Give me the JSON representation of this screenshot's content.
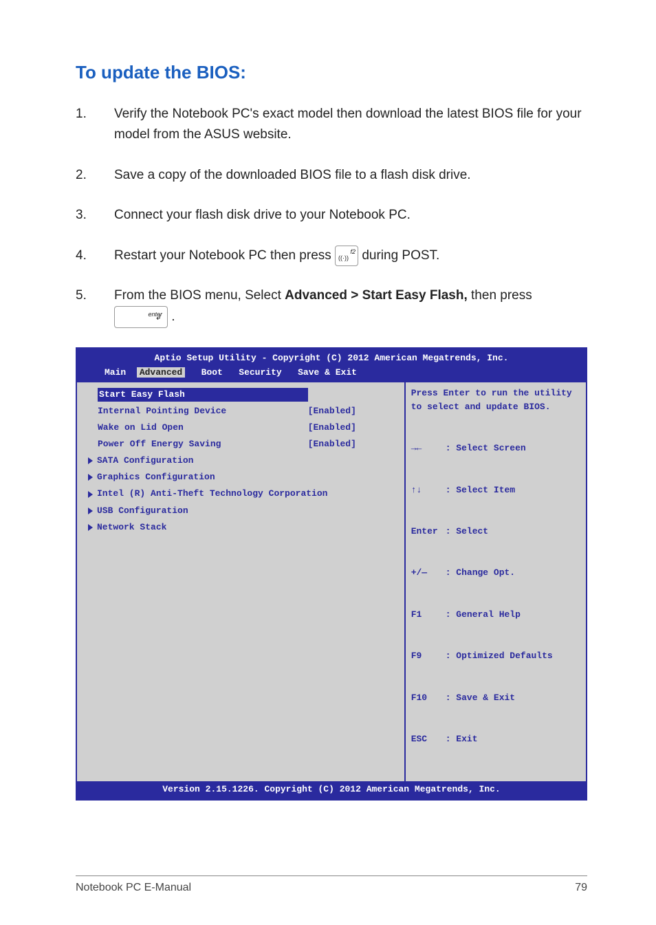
{
  "heading": "To update the BIOS:",
  "steps": {
    "s1": {
      "num": "1.",
      "text": "Verify the Notebook PC's exact model then download the latest BIOS file for your model from the ASUS website."
    },
    "s2": {
      "num": "2.",
      "text": "Save a copy of the downloaded BIOS file to a flash disk drive."
    },
    "s3": {
      "num": "3.",
      "text": "Connect your flash disk drive to your Notebook PC."
    },
    "s4": {
      "num": "4.",
      "pre": "Restart your Notebook PC then press ",
      "post": " during POST."
    },
    "s5": {
      "num": "5.",
      "pre": "From the BIOS menu, Select ",
      "bold": "Advanced > Start Easy Flash,",
      "mid": " then press ",
      "post": "."
    }
  },
  "keys": {
    "f2": {
      "label": "f2",
      "icon": "((·))"
    },
    "enter": {
      "label": "enter",
      "arrow": "↲"
    }
  },
  "bios": {
    "title": "Aptio Setup Utility - Copyright (C) 2012 American Megatrends, Inc.",
    "tabs": {
      "main": "Main",
      "advanced": "Advanced",
      "boot": "Boot",
      "security": "Security",
      "save": "Save & Exit"
    },
    "rows": {
      "r0": {
        "label": "Start Easy Flash",
        "value": ""
      },
      "r1": {
        "label": "Internal Pointing Device",
        "value": "[Enabled]"
      },
      "r2": {
        "label": "Wake on Lid Open",
        "value": "[Enabled]"
      },
      "r3": {
        "label": "Power Off Energy Saving",
        "value": "[Enabled]"
      }
    },
    "subs": {
      "s0": "SATA Configuration",
      "s1": "Graphics Configuration",
      "s2": "Intel (R) Anti-Theft Technology Corporation",
      "s3": "USB Configuration",
      "s4": "Network Stack"
    },
    "help_top": "Press Enter to run the utility to select and update BIOS.",
    "help_bottom": {
      "l0": {
        "k": "→←",
        "t": ": Select Screen"
      },
      "l1": {
        "k": "↑↓",
        "t": ": Select Item"
      },
      "l2": {
        "k": "Enter",
        "t": ": Select"
      },
      "l3": {
        "k": "+/—",
        "t": ": Change Opt."
      },
      "l4": {
        "k": "F1",
        "t": ": General Help"
      },
      "l5": {
        "k": "F9",
        "t": ": Optimized Defaults"
      },
      "l6": {
        "k": "F10",
        "t": ": Save & Exit"
      },
      "l7": {
        "k": "ESC",
        "t": ": Exit"
      }
    },
    "footer": "Version 2.15.1226. Copyright (C) 2012 American Megatrends, Inc."
  },
  "page_footer": {
    "left": "Notebook PC E-Manual",
    "right": "79"
  }
}
